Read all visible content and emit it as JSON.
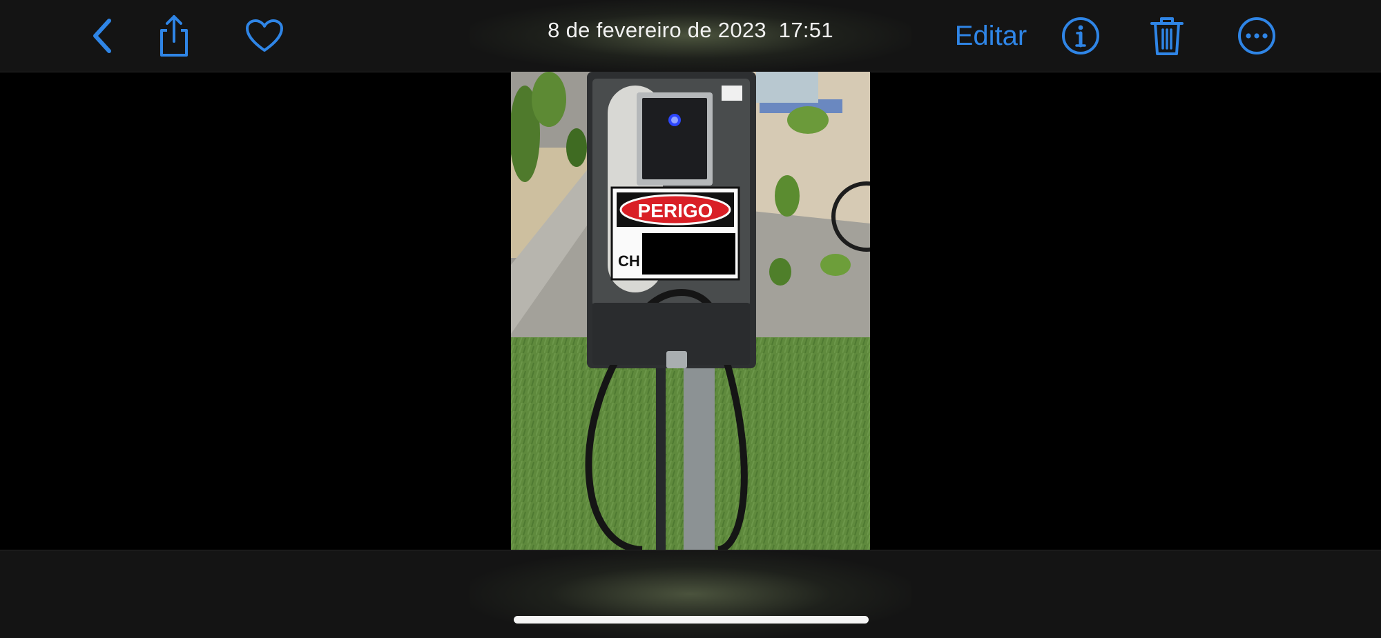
{
  "header": {
    "date": "8 de fevereiro de 2023",
    "time": "17:51",
    "edit_label": "Editar",
    "icons": {
      "back": "chevron-left-icon",
      "share": "share-icon",
      "favorite": "heart-icon",
      "info": "info-icon",
      "delete": "trash-icon",
      "more": "ellipsis-icon"
    }
  },
  "photo": {
    "sign_title": "PERIGO",
    "sign_text": "CH"
  },
  "colors": {
    "accent": "#2f85e6",
    "bar_background": "#141414",
    "sign_red": "#d91f26"
  }
}
